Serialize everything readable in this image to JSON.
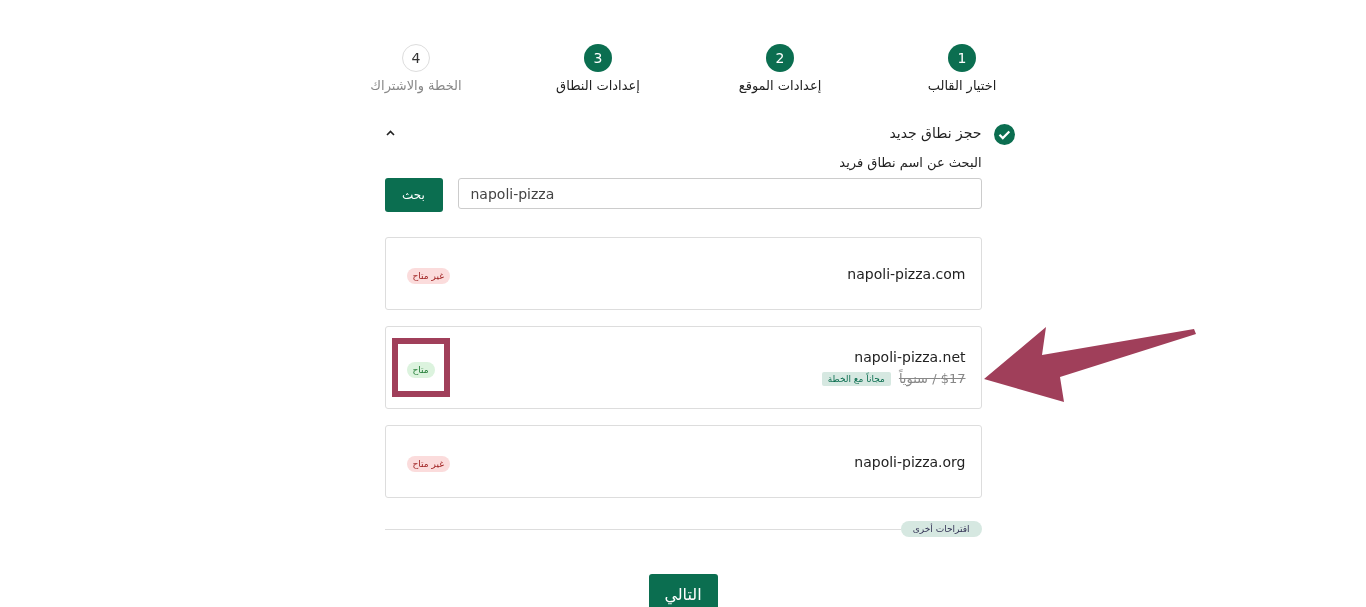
{
  "steps": [
    {
      "number": "1",
      "label": "اختيار القالب",
      "reached": true
    },
    {
      "number": "2",
      "label": "إعدادات الموقع",
      "reached": true
    },
    {
      "number": "3",
      "label": "إعدادات النطاق",
      "reached": true
    },
    {
      "number": "4",
      "label": "الخطة والاشتراك",
      "reached": false
    }
  ],
  "section": {
    "title": "حجز نطاق جديد",
    "completed": true,
    "expanded": true
  },
  "search": {
    "label": "البحث عن اسم نطاق فريد",
    "value": "napoli-pizza",
    "button": "بحث"
  },
  "domains": [
    {
      "name": "napoli-pizza.com",
      "available": false,
      "status": "غير متاح",
      "annotated": false
    },
    {
      "name": "napoli-pizza.net",
      "available": true,
      "status": "متاح",
      "old_price": "$17 / سنوياً",
      "offer": "مجاناً مع الخطة",
      "annotated": true
    },
    {
      "name": "napoli-pizza.org",
      "available": false,
      "status": "غير متاح",
      "annotated": false
    }
  ],
  "more_suggestions": "اقتراحات أخرى",
  "next_button": "التالي"
}
